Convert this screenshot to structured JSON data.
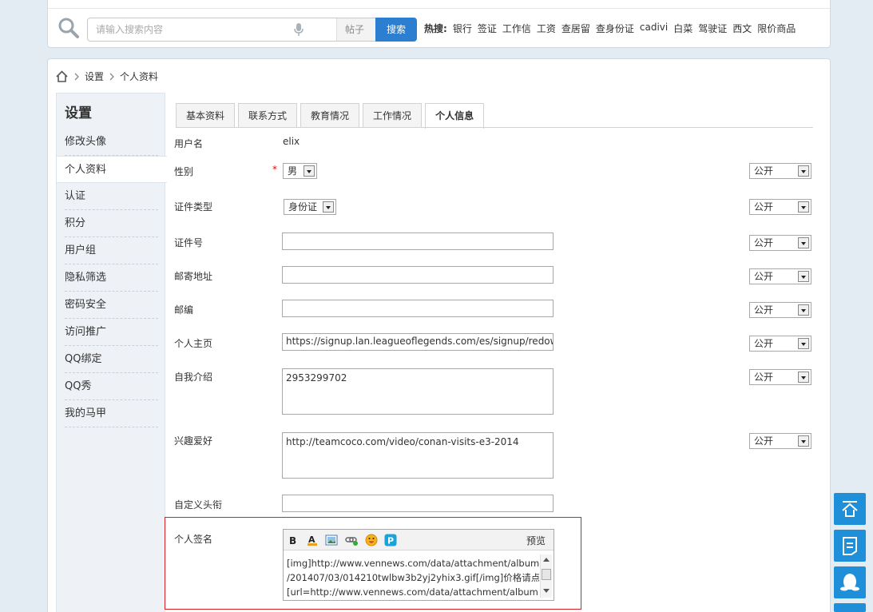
{
  "search": {
    "placeholder": "请输入搜索内容",
    "type_label": "帖子",
    "button_label": "搜索",
    "hot_label": "热搜:",
    "hot_links": [
      "银行",
      "签证",
      "工作信",
      "工资",
      "查居留",
      "查身份证",
      "cadivi",
      "白菜",
      "驾驶证",
      "西文",
      "限价商品"
    ]
  },
  "breadcrumb": {
    "items": [
      "设置",
      "个人资料"
    ]
  },
  "sidebar": {
    "title": "设置",
    "items": [
      "修改头像",
      "个人资料",
      "认证",
      "积分",
      "用户组",
      "隐私筛选",
      "密码安全",
      "访问推广",
      "QQ绑定",
      "QQ秀",
      "我的马甲"
    ],
    "active_index": 1
  },
  "tabs": {
    "items": [
      "基本资料",
      "联系方式",
      "教育情况",
      "工作情况",
      "个人信息"
    ],
    "active_index": 4
  },
  "form": {
    "username": {
      "label": "用户名",
      "value": "elix"
    },
    "gender": {
      "label": "性别",
      "required": "*",
      "value": "男",
      "privacy": "公开"
    },
    "id_type": {
      "label": "证件类型",
      "value": "身份证",
      "privacy": "公开"
    },
    "id_number": {
      "label": "证件号",
      "value": "",
      "privacy": "公开"
    },
    "address": {
      "label": "邮寄地址",
      "value": "",
      "privacy": "公开"
    },
    "zipcode": {
      "label": "邮编",
      "value": "",
      "privacy": "公开"
    },
    "homepage": {
      "label": "个人主页",
      "value": "https://signup.lan.leagueoflegends.com/es/signup/redownlo",
      "privacy": "公开"
    },
    "bio": {
      "label": "自我介绍",
      "value": "2953299702",
      "privacy": "公开"
    },
    "interests": {
      "label": "兴趣爱好",
      "value": "http://teamcoco.com/video/conan-visits-e3-2014",
      "privacy": "公开"
    },
    "custom_title": {
      "label": "自定义头衔",
      "value": ""
    },
    "signature": {
      "label": "个人签名",
      "preview_label": "预览",
      "toolbar_icons": [
        "bold-icon",
        "font-color-icon",
        "image-icon",
        "link-icon",
        "emoji-icon",
        "paypal-icon"
      ],
      "lines": [
        "[img]http://www.vennews.com/data/attachment/album",
        "/201407/03/014210twlbw3b2yj2yhix3.gif[/img]价格请点",
        "[url=http://www.vennews.com/data/attachment/album"
      ]
    }
  },
  "colors": {
    "accent": "#2c7fd0",
    "float_button": "#1e8fd8",
    "signature_border": "#d9202a",
    "page_bg": "#e3ecf3"
  },
  "float_buttons": [
    "back-to-top-icon",
    "feedback-icon",
    "qq-icon"
  ]
}
